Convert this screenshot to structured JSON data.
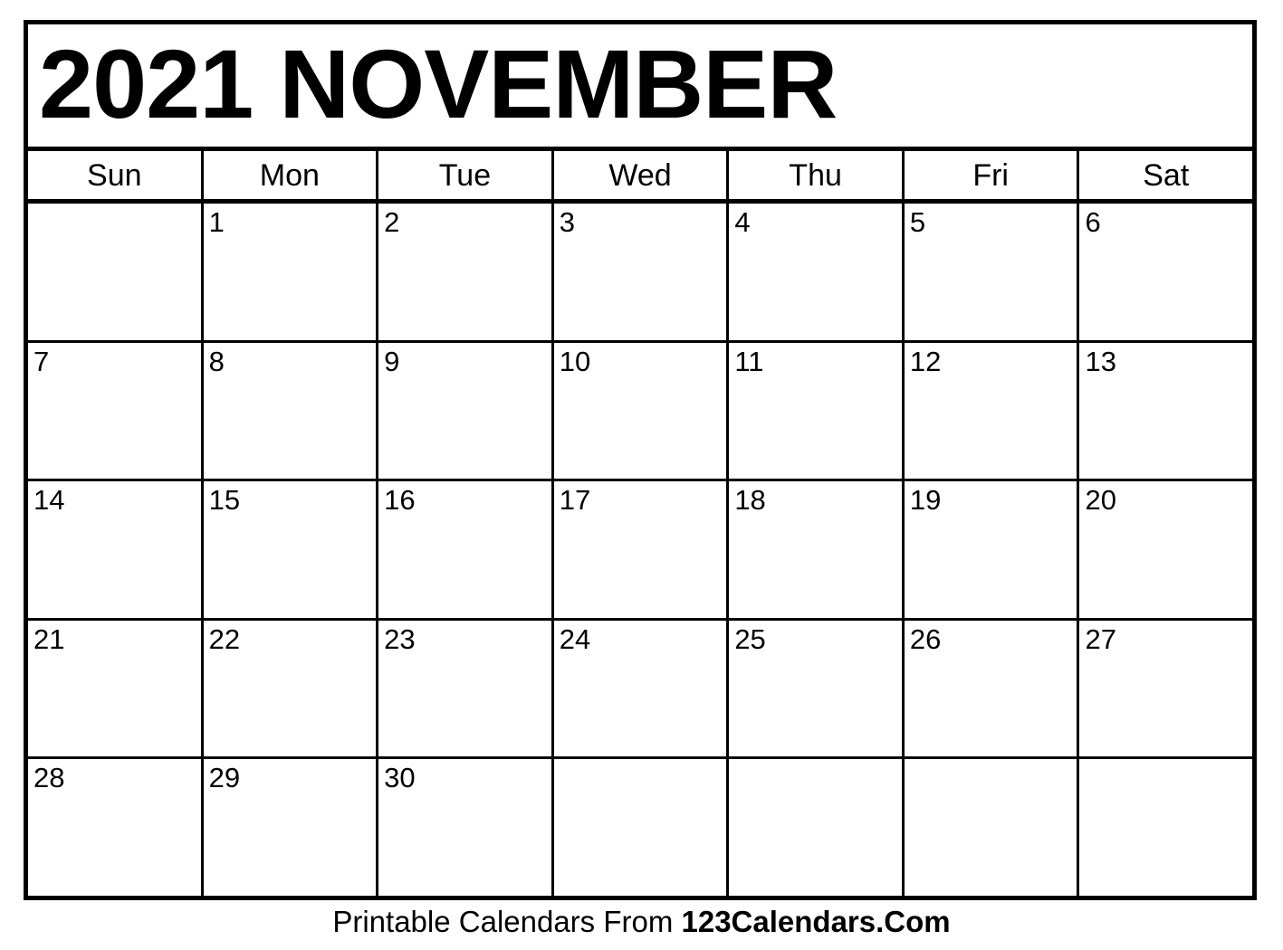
{
  "calendar": {
    "title": "2021 NOVEMBER",
    "year": "2021",
    "month": "NOVEMBER",
    "weekdays": [
      {
        "label": "Sun"
      },
      {
        "label": "Mon"
      },
      {
        "label": "Tue"
      },
      {
        "label": "Wed"
      },
      {
        "label": "Thu"
      },
      {
        "label": "Fri"
      },
      {
        "label": "Sat"
      }
    ],
    "weeks": [
      [
        {
          "date": ""
        },
        {
          "date": "1"
        },
        {
          "date": "2"
        },
        {
          "date": "3"
        },
        {
          "date": "4"
        },
        {
          "date": "5"
        },
        {
          "date": "6"
        }
      ],
      [
        {
          "date": "7"
        },
        {
          "date": "8"
        },
        {
          "date": "9"
        },
        {
          "date": "10"
        },
        {
          "date": "11"
        },
        {
          "date": "12"
        },
        {
          "date": "13"
        }
      ],
      [
        {
          "date": "14"
        },
        {
          "date": "15"
        },
        {
          "date": "16"
        },
        {
          "date": "17"
        },
        {
          "date": "18"
        },
        {
          "date": "19"
        },
        {
          "date": "20"
        }
      ],
      [
        {
          "date": "21"
        },
        {
          "date": "22"
        },
        {
          "date": "23"
        },
        {
          "date": "24"
        },
        {
          "date": "25"
        },
        {
          "date": "26"
        },
        {
          "date": "27"
        }
      ],
      [
        {
          "date": "28"
        },
        {
          "date": "29"
        },
        {
          "date": "30"
        },
        {
          "date": ""
        },
        {
          "date": ""
        },
        {
          "date": ""
        },
        {
          "date": ""
        }
      ]
    ]
  },
  "footer": {
    "prefix": "Printable Calendars From ",
    "brand": "123Calendars.Com"
  },
  "colors": {
    "ink": "#000000",
    "paper": "#ffffff"
  }
}
